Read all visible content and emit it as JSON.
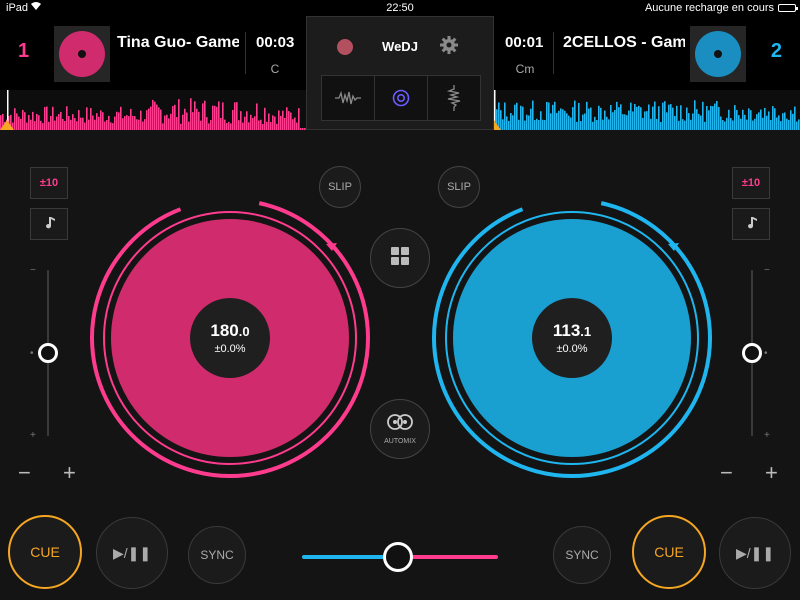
{
  "status_bar": {
    "carrier": "iPad",
    "time": "22:50",
    "battery_text": "Aucune recharge en cours"
  },
  "app": {
    "brand": "WeDJ"
  },
  "deck_a": {
    "number": "1",
    "title": "Tina Guo- Game",
    "time": "00:03",
    "key": "C",
    "color": "#ff3b8e",
    "platter_color": "#cf2b6d",
    "bpm_main": "180",
    "bpm_decimal": ".0",
    "pitch_offset": "±0.0%",
    "pitch_range": "±10",
    "slip_label": "SLIP",
    "cue_label": "CUE",
    "play_label": "▶/❚❚",
    "sync_label": "SYNC",
    "pitch_slider_level": 0.5
  },
  "deck_b": {
    "number": "2",
    "title": "2CELLOS - Gam",
    "time": "00:01",
    "key": "Cm",
    "color": "#1fb6f0",
    "platter_color": "#1a9fd1",
    "bpm_main": "113",
    "bpm_decimal": ".1",
    "pitch_offset": "±0.0%",
    "pitch_range": "±10",
    "slip_label": "SLIP",
    "cue_label": "CUE",
    "play_label": "▶/❚❚",
    "sync_label": "SYNC",
    "pitch_slider_level": 0.5
  },
  "center": {
    "automix_label": "AUTOMIX",
    "view_tabs": [
      "waveform-icon",
      "turntable-icon",
      "vertical-waveform-icon"
    ],
    "active_view_tab": 1
  },
  "pitch_marks": {
    "minus": "−",
    "plus": "+"
  },
  "crossfader": {
    "position": 0.49
  },
  "colors": {
    "accent_cue": "#f5a623",
    "deck_a": "#ff3b8e",
    "deck_b": "#1fb6f0"
  }
}
